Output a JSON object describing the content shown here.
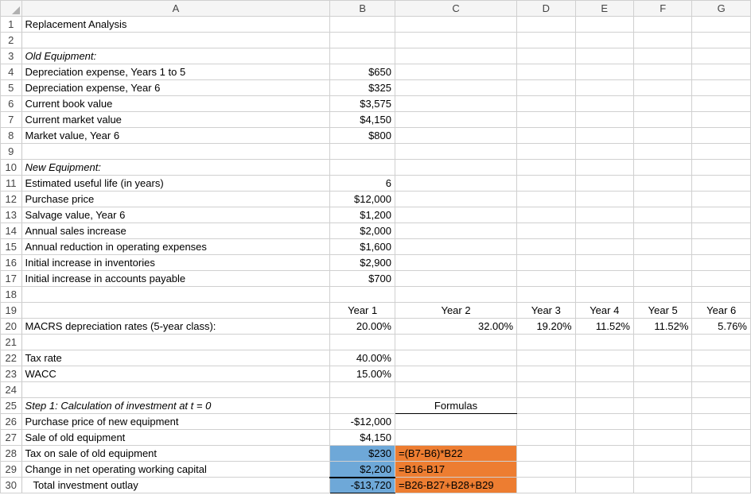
{
  "columns": [
    "A",
    "B",
    "C",
    "D",
    "E",
    "F",
    "G"
  ],
  "rows": {
    "1": {
      "A": "Replacement Analysis"
    },
    "3": {
      "A": "Old Equipment:"
    },
    "4": {
      "A": "Depreciation expense, Years 1 to 5",
      "B": "$650"
    },
    "5": {
      "A": "Depreciation expense, Year 6",
      "B": "$325"
    },
    "6": {
      "A": "Current book value",
      "B": "$3,575"
    },
    "7": {
      "A": "Current market value",
      "B": "$4,150"
    },
    "8": {
      "A": "Market value, Year 6",
      "B": "$800"
    },
    "10": {
      "A": "New Equipment:"
    },
    "11": {
      "A": "Estimated useful life (in years)",
      "B": "6"
    },
    "12": {
      "A": "Purchase price",
      "B": "$12,000"
    },
    "13": {
      "A": "Salvage value, Year 6",
      "B": "$1,200"
    },
    "14": {
      "A": "Annual sales increase",
      "B": "$2,000"
    },
    "15": {
      "A": "Annual reduction in operating expenses",
      "B": "$1,600"
    },
    "16": {
      "A": "Initial increase in inventories",
      "B": "$2,900"
    },
    "17": {
      "A": "Initial increase in accounts payable",
      "B": "$700"
    },
    "19": {
      "B": "Year 1",
      "C": "Year 2",
      "D": "Year 3",
      "E": "Year 4",
      "F": "Year 5",
      "G": "Year 6"
    },
    "20": {
      "A": "MACRS depreciation rates (5-year class):",
      "B": "20.00%",
      "C": "32.00%",
      "D": "19.20%",
      "E": "11.52%",
      "F": "11.52%",
      "G": "5.76%"
    },
    "22": {
      "A": "Tax rate",
      "B": "40.00%"
    },
    "23": {
      "A": "WACC",
      "B": "15.00%"
    },
    "25": {
      "A": "Step 1: Calculation of investment at t = 0",
      "C": "Formulas"
    },
    "26": {
      "A": "Purchase price of new equipment",
      "B": "-$12,000"
    },
    "27": {
      "A": "Sale of old equipment",
      "B": "$4,150"
    },
    "28": {
      "A": "Tax on sale of old equipment",
      "B": "$230",
      "C": "=(B7-B6)*B22"
    },
    "29": {
      "A": "Change in net operating working capital",
      "B": "$2,200",
      "C": "=B16-B17"
    },
    "30": {
      "A": "Total investment outlay",
      "B": "-$13,720",
      "C": "=B26-B27+B28+B29"
    }
  },
  "chart_data": {
    "type": "table",
    "title": "Replacement Analysis",
    "sections": {
      "old_equipment": {
        "depreciation_years_1_5": 650,
        "depreciation_year_6": 325,
        "current_book_value": 3575,
        "current_market_value": 4150,
        "market_value_year_6": 800
      },
      "new_equipment": {
        "estimated_useful_life_years": 6,
        "purchase_price": 12000,
        "salvage_value_year_6": 1200,
        "annual_sales_increase": 2000,
        "annual_reduction_operating_expenses": 1600,
        "initial_increase_inventories": 2900,
        "initial_increase_accounts_payable": 700
      },
      "macrs_5yr_rates": {
        "categories": [
          "Year 1",
          "Year 2",
          "Year 3",
          "Year 4",
          "Year 5",
          "Year 6"
        ],
        "values_pct": [
          20.0,
          32.0,
          19.2,
          11.52,
          11.52,
          5.76
        ]
      },
      "assumptions": {
        "tax_rate_pct": 40.0,
        "wacc_pct": 15.0
      },
      "step1_investment_t0": {
        "purchase_price_new_equipment": -12000,
        "sale_of_old_equipment": 4150,
        "tax_on_sale_of_old_equipment": 230,
        "change_in_net_operating_working_capital": 2200,
        "total_investment_outlay": -13720,
        "formulas": {
          "tax_on_sale_of_old_equipment": "=(B7-B6)*B22",
          "change_in_net_operating_working_capital": "=B16-B17",
          "total_investment_outlay": "=B26-B27+B28+B29"
        }
      }
    }
  }
}
